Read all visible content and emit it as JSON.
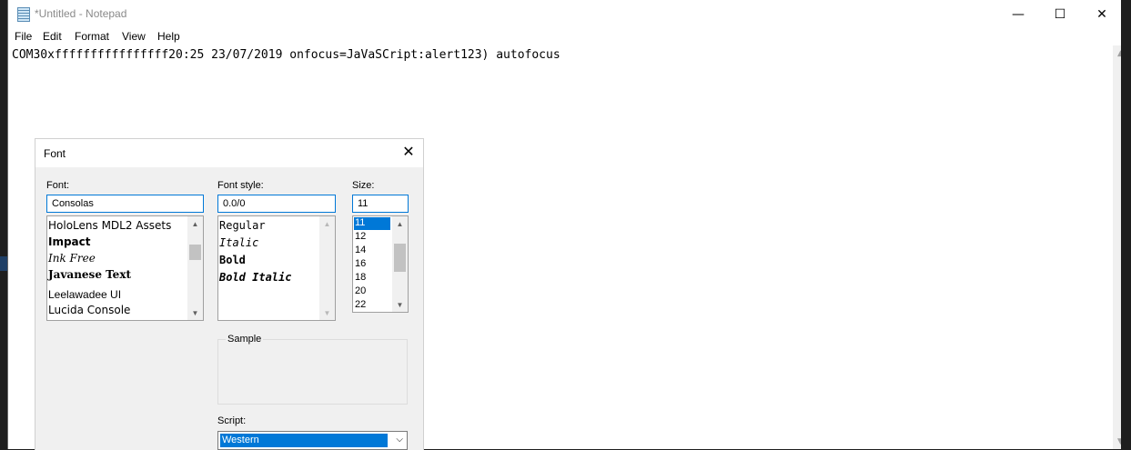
{
  "window": {
    "title": "*Untitled - Notepad",
    "minimize_glyph": "—",
    "maximize_glyph": "☐",
    "close_glyph": "✕"
  },
  "menu": [
    "File",
    "Edit",
    "Format",
    "View",
    "Help"
  ],
  "editor": {
    "content": "COM30xffffffffffffffff20:25 23/07/2019 onfocus=JaVaSCript:alert123) autofocus"
  },
  "font_dialog": {
    "title": "Font",
    "close_glyph": "✕",
    "font_label": "Font:",
    "font_value": "Consolas",
    "fonts": [
      "HoloLens MDL2 Assets",
      "Impact",
      "Ink Free",
      "Javanese Text",
      "Leelawadee UI",
      "Lucida Console"
    ],
    "style_label": "Font style:",
    "style_value": "0.0/0",
    "styles": [
      "Regular",
      "Italic",
      "Bold",
      "Bold Italic"
    ],
    "size_label": "Size:",
    "size_value": "11",
    "sizes": [
      "11",
      "12",
      "14",
      "16",
      "18",
      "20",
      "22"
    ],
    "selected_size": "11",
    "sample_label": "Sample",
    "script_label": "Script:",
    "script_value": "Western"
  },
  "colors": {
    "accent": "#0078d7",
    "dialog_bg": "#f0f0f0"
  }
}
